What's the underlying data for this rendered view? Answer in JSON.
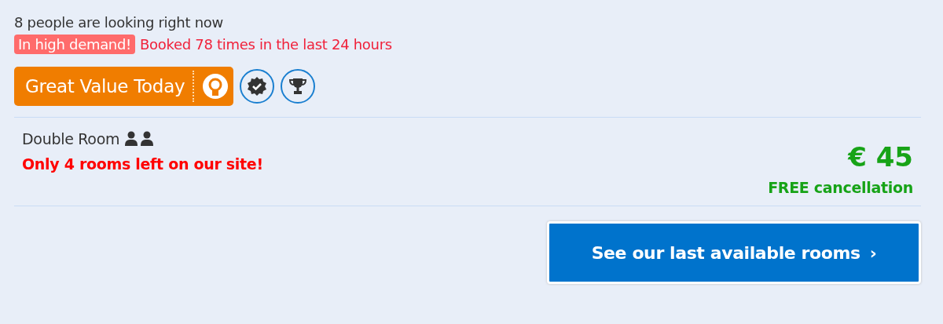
{
  "viewers": "8 people are looking right now",
  "demand": {
    "badge": "In high demand!",
    "text": "Booked 78 times in the last 24 hours"
  },
  "value_badge": {
    "label": "Great Value Today"
  },
  "room": {
    "name": "Double Room",
    "availability": "Only 4 rooms left on our site!",
    "price": "€ 45",
    "cancellation": "FREE cancellation"
  },
  "cta": {
    "label": "See our last available rooms",
    "chevron": "›"
  }
}
